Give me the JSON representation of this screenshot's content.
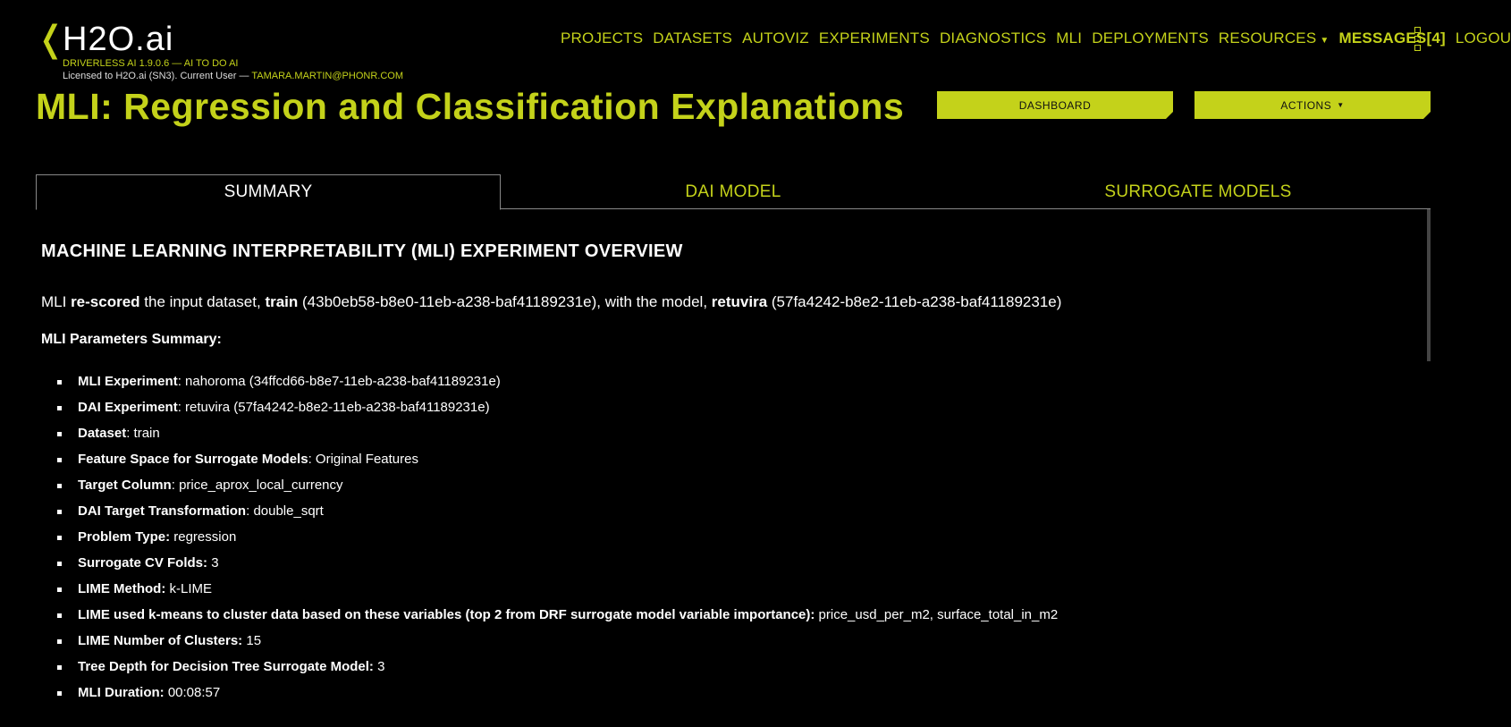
{
  "brand": {
    "chevron": "❬",
    "title": "H2O.ai",
    "subtitle": "DRIVERLESS AI 1.9.0.6 — AI TO DO AI",
    "license_prefix": "Licensed to H2O.ai (SN3). Current User —",
    "user": "TAMARA.MARTIN@PHONR.COM"
  },
  "nav": {
    "projects": "PROJECTS",
    "datasets": "DATASETS",
    "autoviz": "AUTOVIZ",
    "experiments": "EXPERIMENTS",
    "diagnostics": "DIAGNOSTICS",
    "mli": "MLI",
    "deployments": "DEPLOYMENTS",
    "resources": "RESOURCES",
    "resources_caret": "▼",
    "messages": "MESSAGES[4]",
    "logout": "LOGOUT"
  },
  "page": {
    "title": "MLI: Regression and Classification Explanations"
  },
  "buttons": {
    "dashboard": "DASHBOARD",
    "actions": "ACTIONS",
    "actions_caret": "▼"
  },
  "tabs": {
    "summary": "SUMMARY",
    "dai_model": "DAI MODEL",
    "surrogate_models": "SURROGATE MODELS"
  },
  "summary": {
    "overview_title": "MACHINE LEARNING INTERPRETABILITY (MLI) EXPERIMENT OVERVIEW",
    "rescore": {
      "t1": "MLI ",
      "b1": "re-scored",
      "t2": " the input dataset, ",
      "b2": "train",
      "t3": " (43b0eb58-b8e0-11eb-a238-baf41189231e), with the model, ",
      "b3": "retuvira",
      "t4": " (57fa4242-b8e2-11eb-a238-baf41189231e)"
    },
    "params_title": "MLI Parameters Summary:",
    "params": [
      {
        "label": "MLI Experiment",
        "sep": ": ",
        "value": "nahoroma (34ffcd66-b8e7-11eb-a238-baf41189231e)"
      },
      {
        "label": "DAI Experiment",
        "sep": ": ",
        "value": "retuvira (57fa4242-b8e2-11eb-a238-baf41189231e)"
      },
      {
        "label": "Dataset",
        "sep": ": ",
        "value": "train"
      },
      {
        "label": "Feature Space for Surrogate Models",
        "sep": ": ",
        "value": "Original Features"
      },
      {
        "label": "Target Column",
        "sep": ": ",
        "value": "price_aprox_local_currency"
      },
      {
        "label": "DAI Target Transformation",
        "sep": ": ",
        "value": "double_sqrt"
      },
      {
        "label": "Problem Type:",
        "sep": " ",
        "value": "regression"
      },
      {
        "label": "Surrogate CV Folds:",
        "sep": " ",
        "value": "3"
      },
      {
        "label": "LIME Method:",
        "sep": " ",
        "value": "k-LIME"
      },
      {
        "label": "LIME used k-means to cluster data based on these variables (top 2 from DRF surrogate model variable importance):",
        "sep": " ",
        "value": "price_usd_per_m2, surface_total_in_m2"
      },
      {
        "label": "LIME Number of Clusters:",
        "sep": " ",
        "value": "15"
      },
      {
        "label": "Tree Depth for Decision Tree Surrogate Model:",
        "sep": " ",
        "value": "3"
      },
      {
        "label": "MLI Duration:",
        "sep": " ",
        "value": "00:08:57"
      }
    ]
  }
}
